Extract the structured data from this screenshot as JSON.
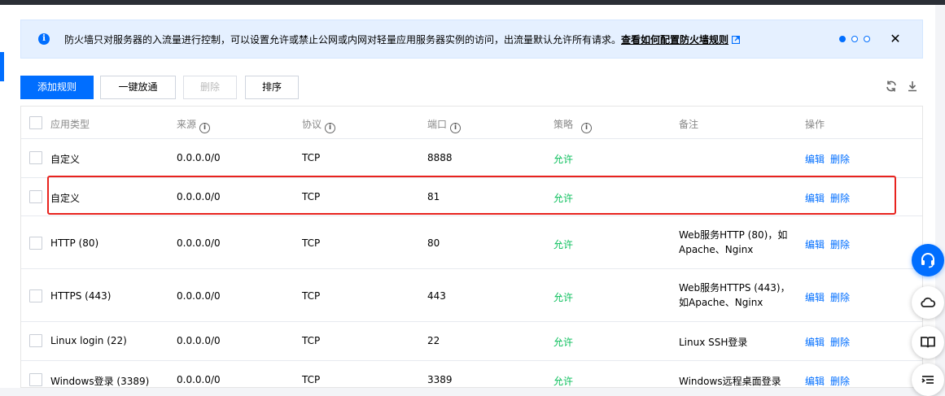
{
  "notice": {
    "message": "防火墙只对服务器的入流量进行控制，可以设置允许或禁止公网或内网对轻量应用服务器实例的访问，出流量默认允许所有请求。",
    "link_text": "查看如何配置防火墙规则"
  },
  "toolbar": {
    "add_rule": "添加规则",
    "one_click_open": "一键放通",
    "delete": "删除",
    "sort": "排序"
  },
  "table": {
    "headers": {
      "app_type": "应用类型",
      "source": "来源",
      "protocol": "协议",
      "port": "端口",
      "policy": "策略",
      "remark": "备注",
      "actions": "操作"
    },
    "rows": [
      {
        "app_type": "自定义",
        "source": "0.0.0.0/0",
        "protocol": "TCP",
        "port": "8888",
        "policy": "允许",
        "remark": "",
        "edit": "编辑",
        "delete": "删除"
      },
      {
        "app_type": "自定义",
        "source": "0.0.0.0/0",
        "protocol": "TCP",
        "port": "81",
        "policy": "允许",
        "remark": "",
        "edit": "编辑",
        "delete": "删除"
      },
      {
        "app_type": "HTTP (80)",
        "source": "0.0.0.0/0",
        "protocol": "TCP",
        "port": "80",
        "policy": "允许",
        "remark": "Web服务HTTP (80)，如Apache、Nginx",
        "edit": "编辑",
        "delete": "删除"
      },
      {
        "app_type": "HTTPS (443)",
        "source": "0.0.0.0/0",
        "protocol": "TCP",
        "port": "443",
        "policy": "允许",
        "remark": "Web服务HTTPS (443)，如Apache、Nginx",
        "edit": "编辑",
        "delete": "删除"
      },
      {
        "app_type": "Linux login (22)",
        "source": "0.0.0.0/0",
        "protocol": "TCP",
        "port": "22",
        "policy": "允许",
        "remark": "Linux SSH登录",
        "edit": "编辑",
        "delete": "删除"
      },
      {
        "app_type": "Windows登录 (3389)",
        "source": "0.0.0.0/0",
        "protocol": "TCP",
        "port": "3389",
        "policy": "允许",
        "remark": "Windows远程桌面登录",
        "edit": "编辑",
        "delete": "删除"
      }
    ]
  },
  "colors": {
    "accent": "#006eff",
    "allow": "#0abf5b",
    "highlight": "#e8231e"
  },
  "icons": [
    "info-icon",
    "external-link-icon",
    "close-icon",
    "refresh-icon",
    "download-icon",
    "headset-icon",
    "cloud-icon",
    "book-icon",
    "list-icon"
  ]
}
